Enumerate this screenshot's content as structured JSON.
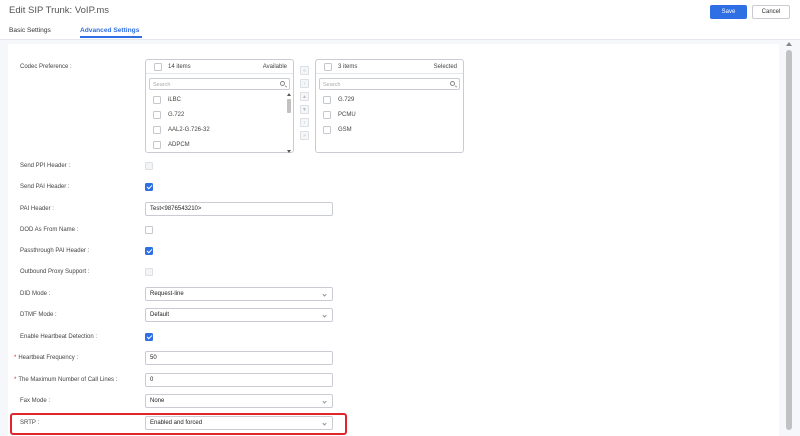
{
  "header": {
    "title": "Edit SIP Trunk: VoIP.ms",
    "save_label": "Save",
    "cancel_label": "Cancel"
  },
  "tabs": [
    {
      "label": "Basic Settings",
      "active": false
    },
    {
      "label": "Advanced Settings",
      "active": true
    }
  ],
  "codec": {
    "label": "Codec Preference :",
    "available": {
      "count": "14 items",
      "title": "Available",
      "search_placeholder": "Search",
      "items": [
        "iLBC",
        "G.722",
        "AAL2-G.726-32",
        "ADPCM"
      ]
    },
    "selected": {
      "count": "3 items",
      "title": "Selected",
      "search_placeholder": "Search",
      "items": [
        "G.729",
        "PCMU",
        "GSM"
      ]
    },
    "move_buttons": [
      "«",
      "‹",
      "▲",
      "▼",
      "›",
      "»"
    ]
  },
  "fields": {
    "send_ppi": {
      "label": "Send PPI Header :",
      "checked": false,
      "disabled": true
    },
    "send_pai": {
      "label": "Send PAI Header :",
      "checked": true
    },
    "pai_header": {
      "label": "PAI Header :",
      "value": "Test<9876543210>"
    },
    "did_as_from": {
      "label": "DOD As From Name :",
      "checked": false
    },
    "passthrough_pai": {
      "label": "Passthrough PAI Header :",
      "checked": true
    },
    "outbound_proxy": {
      "label": "Outbound Proxy Support :",
      "checked": false,
      "disabled": true
    },
    "did_mode": {
      "label": "DID Mode :",
      "value": "Request-line"
    },
    "dtmf_mode": {
      "label": "DTMF Mode :",
      "value": "Default"
    },
    "heartbeat_detection": {
      "label": "Enable Heartbeat Detection :",
      "checked": true
    },
    "heartbeat_frequency": {
      "required": "*",
      "label": "Heartbeat Frequency :",
      "value": "50"
    },
    "max_call_lines": {
      "required": "*",
      "label": "The Maximum Number of Call Lines :",
      "value": "0"
    },
    "fax_mode": {
      "label": "Fax Mode :",
      "value": "None"
    },
    "srtp": {
      "label": "SRTP :",
      "value": "Enabled and forced"
    }
  },
  "colors": {
    "accent": "#2f6fe4",
    "highlight": "#e0262c",
    "required": "#e02020"
  }
}
